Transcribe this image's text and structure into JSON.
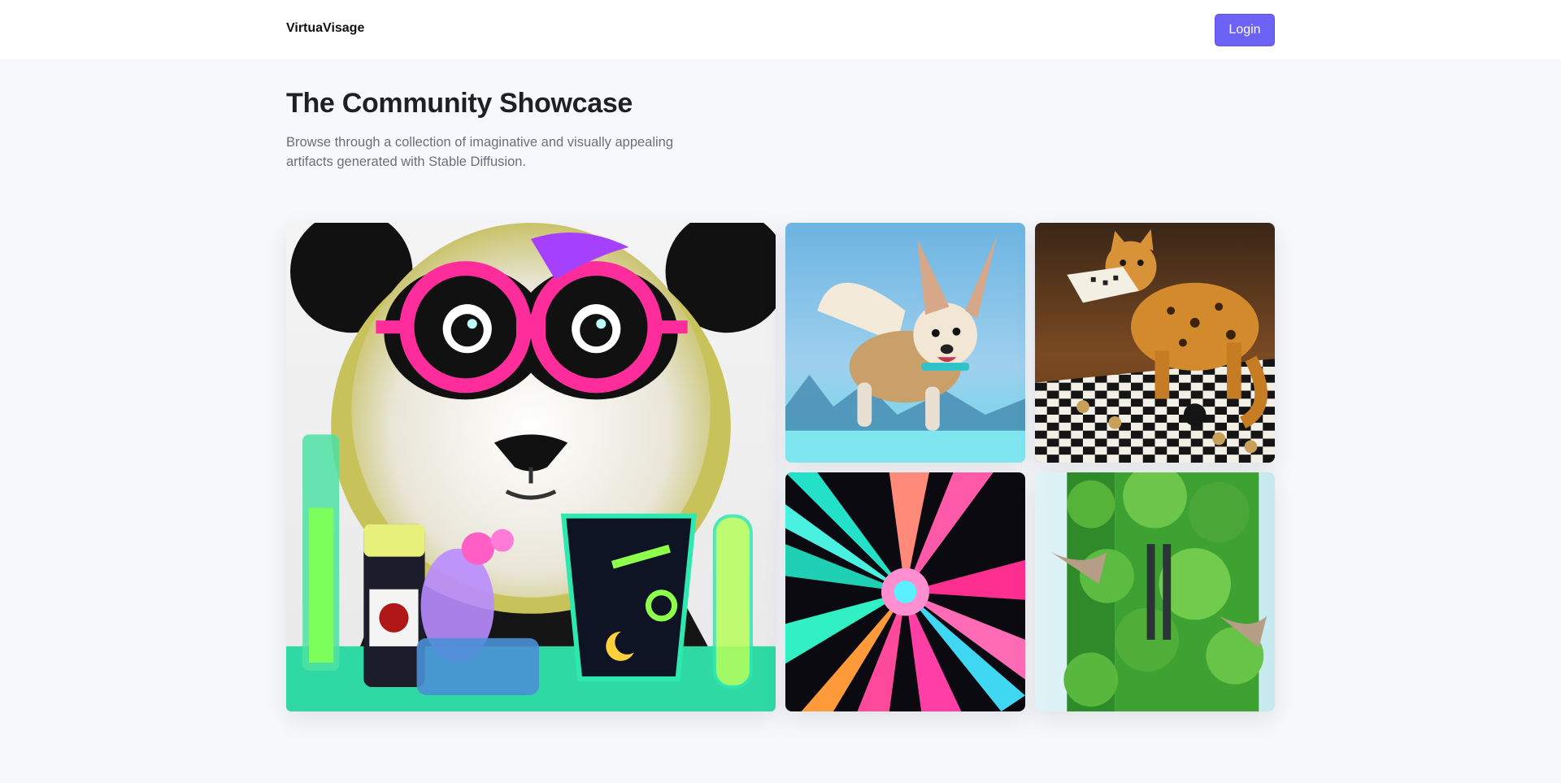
{
  "nav": {
    "brand": "VirtuaVisage",
    "login_label": "Login",
    "accent_color": "#6c63f6"
  },
  "hero": {
    "title": "The Community Showcase",
    "subtitle": "Browse through a collection of imaginative and visually appealing artifacts generated with Stable Diffusion."
  },
  "gallery": {
    "items": [
      {
        "subject": "panda-scientist"
      },
      {
        "subject": "winged-fox-dog"
      },
      {
        "subject": "chess-cat"
      },
      {
        "subject": "color-burst"
      },
      {
        "subject": "green-tower"
      }
    ]
  }
}
